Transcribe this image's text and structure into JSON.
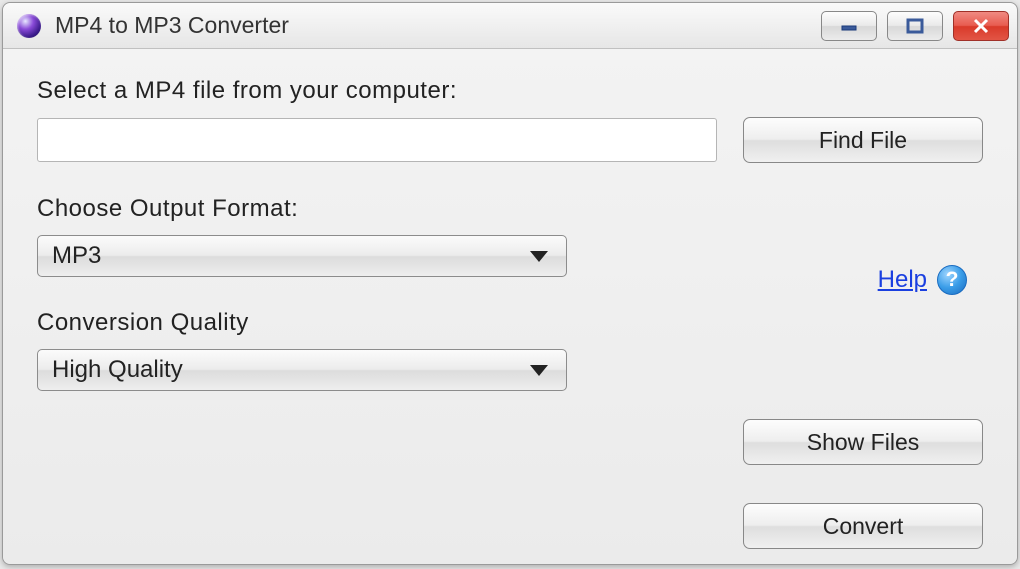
{
  "window": {
    "title": "MP4 to MP3 Converter"
  },
  "labels": {
    "select_file": "Select a MP4 file from your computer:",
    "output_format": "Choose Output Format:",
    "quality": "Conversion Quality"
  },
  "inputs": {
    "file_path": "",
    "file_placeholder": ""
  },
  "buttons": {
    "find_file": "Find File",
    "show_files": "Show Files",
    "convert": "Convert"
  },
  "selects": {
    "output_format_value": "MP3",
    "quality_value": "High Quality"
  },
  "help": {
    "link_text": "Help",
    "icon_char": "?"
  }
}
